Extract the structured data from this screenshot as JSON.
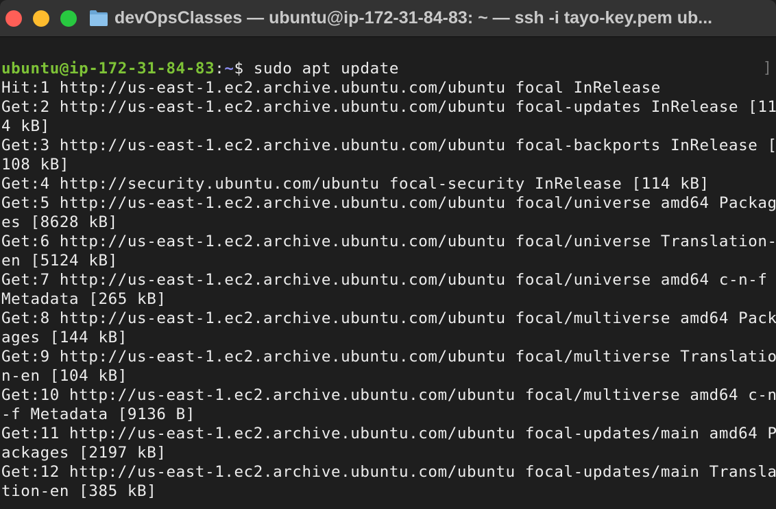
{
  "window": {
    "title": "devOpsClasses — ubuntu@ip-172-31-84-83: ~ — ssh -i tayo-key.pem ub..."
  },
  "terminal": {
    "prompt": {
      "user_host": "ubuntu@ip-172-31-84-83",
      "colon": ":",
      "path": "~",
      "symbol": "$",
      "command": " sudo apt update"
    },
    "scroll_marker": "]",
    "output_lines": [
      "Hit:1 http://us-east-1.ec2.archive.ubuntu.com/ubuntu focal InRelease",
      "Get:2 http://us-east-1.ec2.archive.ubuntu.com/ubuntu focal-updates InRelease [11",
      "4 kB]",
      "Get:3 http://us-east-1.ec2.archive.ubuntu.com/ubuntu focal-backports InRelease [",
      "108 kB]",
      "Get:4 http://security.ubuntu.com/ubuntu focal-security InRelease [114 kB]",
      "Get:5 http://us-east-1.ec2.archive.ubuntu.com/ubuntu focal/universe amd64 Packag",
      "es [8628 kB]",
      "Get:6 http://us-east-1.ec2.archive.ubuntu.com/ubuntu focal/universe Translation-",
      "en [5124 kB]",
      "Get:7 http://us-east-1.ec2.archive.ubuntu.com/ubuntu focal/universe amd64 c-n-f",
      "Metadata [265 kB]",
      "Get:8 http://us-east-1.ec2.archive.ubuntu.com/ubuntu focal/multiverse amd64 Pack",
      "ages [144 kB]",
      "Get:9 http://us-east-1.ec2.archive.ubuntu.com/ubuntu focal/multiverse Translatio",
      "n-en [104 kB]",
      "Get:10 http://us-east-1.ec2.archive.ubuntu.com/ubuntu focal/multiverse amd64 c-n",
      "-f Metadata [9136 B]",
      "Get:11 http://us-east-1.ec2.archive.ubuntu.com/ubuntu focal-updates/main amd64 P",
      "ackages [2197 kB]",
      "Get:12 http://us-east-1.ec2.archive.ubuntu.com/ubuntu focal-updates/main Transla",
      "tion-en [385 kB]"
    ]
  },
  "colors": {
    "close": "#fe5f57",
    "minimize": "#febc2e",
    "zoom": "#28c840",
    "prompt_user": "#7ec337",
    "prompt_path": "#8a8cf0",
    "text": "#ececec",
    "background": "#1e1e1e"
  },
  "icons": {
    "folder": "folder-icon"
  }
}
